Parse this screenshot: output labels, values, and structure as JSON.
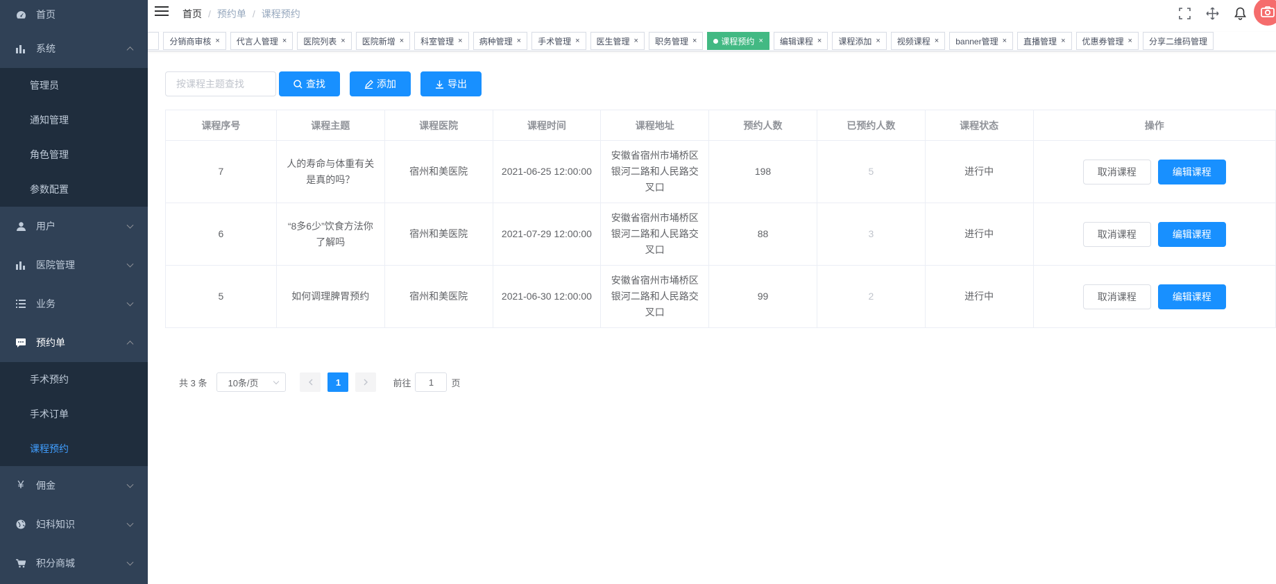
{
  "colors": {
    "sidebar_bg": "#304156",
    "submenu_bg": "#1f2d3d",
    "primary": "#1890ff",
    "active_tag": "#42b983",
    "avatar": "#f56c6c"
  },
  "sidebar": {
    "home": "首页",
    "system": {
      "label": "系统",
      "items": [
        "管理员",
        "通知管理",
        "角色管理",
        "参数配置"
      ]
    },
    "user": "用户",
    "hospital": "医院管理",
    "business": "业务",
    "booking": {
      "label": "预约单",
      "items": [
        "手术预约",
        "手术订单",
        "课程预约"
      ]
    },
    "commission": "佣金",
    "gyn": "妇科知识",
    "points": "积分商城"
  },
  "navbar": {
    "breadcrumb": [
      "首页",
      "预约单",
      "课程预约"
    ],
    "icons": [
      "fullscreen-icon",
      "move-icon",
      "bell-icon",
      "camera-icon"
    ]
  },
  "tags": [
    "分销商审核",
    "代言人管理",
    "医院列表",
    "医院新增",
    "科室管理",
    "病种管理",
    "手术管理",
    "医生管理",
    "职务管理",
    "课程预约",
    "编辑课程",
    "课程添加",
    "视频课程",
    "banner管理",
    "直播管理",
    "优惠券管理",
    "分享二维码管理"
  ],
  "tags_close": "×",
  "toolbar": {
    "search_placeholder": "按课程主题查找",
    "search_btn": "查找",
    "add_btn": "添加",
    "export_btn": "导出"
  },
  "table": {
    "headers": [
      "课程序号",
      "课程主题",
      "课程医院",
      "课程时间",
      "课程地址",
      "预约人数",
      "已预约人数",
      "课程状态",
      "操作"
    ],
    "rows": [
      {
        "id": "7",
        "topic": "人的寿命与体重有关是真的吗？",
        "hospital": "宿州和美医院",
        "time": "2021-06-25 12:00:00",
        "address": "安徽省宿州市埇桥区银河二路和人民路交叉口",
        "quota": "198",
        "booked": "5",
        "status": "进行中"
      },
      {
        "id": "6",
        "topic": "“8多6少”饮食方法你了解吗",
        "hospital": "宿州和美医院",
        "time": "2021-07-29 12:00:00",
        "address": "安徽省宿州市埇桥区银河二路和人民路交叉口",
        "quota": "88",
        "booked": "3",
        "status": "进行中"
      },
      {
        "id": "5",
        "topic": "如何调理脾胃预约",
        "hospital": "宿州和美医院",
        "time": "2021-06-30 12:00:00",
        "address": "安徽省宿州市埇桥区银河二路和人民路交叉口",
        "quota": "99",
        "booked": "2",
        "status": "进行中"
      }
    ],
    "cancel_btn": "取消课程",
    "edit_btn": "编辑课程"
  },
  "pagination": {
    "total": "共 3 条",
    "page_size": "10条/页",
    "current": "1",
    "goto_prefix": "前往",
    "goto_value": "1",
    "goto_suffix": "页"
  }
}
